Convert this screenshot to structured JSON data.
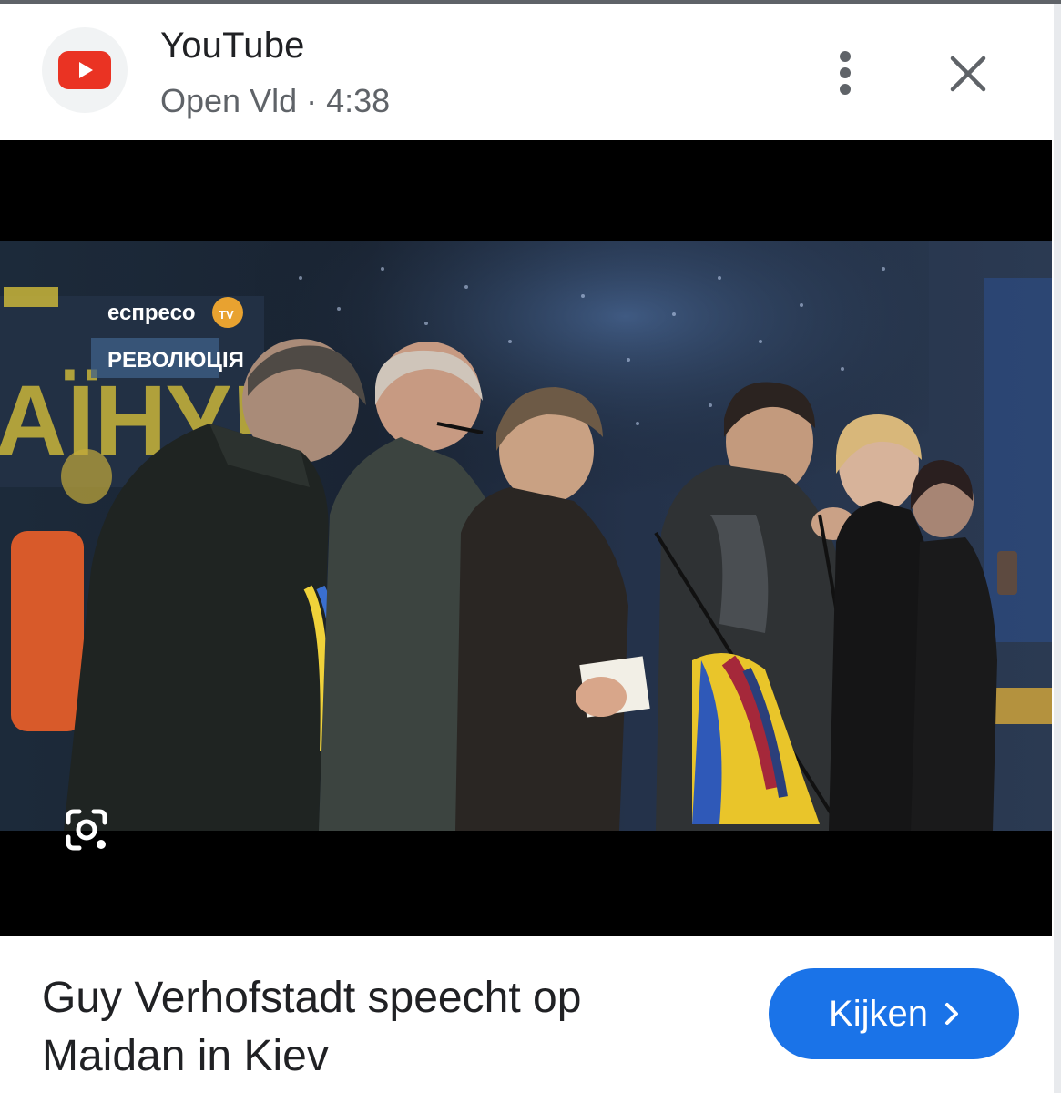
{
  "header": {
    "app_icon": "youtube-icon",
    "title": "YouTube",
    "subtitle": "Open Vld · 4:38",
    "more_icon": "more-vert-icon",
    "close_icon": "close-icon"
  },
  "video": {
    "overlay": {
      "channel_logo": "еспресо",
      "channel_badge": "TV",
      "program_label": "РЕВОЛЮЦІЯ",
      "banner_text": "АЇНУ!"
    },
    "lens_icon": "google-lens-icon"
  },
  "caption": "Guy Verhofstadt speecht op Maidan in Kiev",
  "watch_button": {
    "label": "Kijken",
    "icon": "chevron-right-icon"
  },
  "colors": {
    "accent": "#1a73e8",
    "youtube_red": "#ea3323",
    "text_primary": "#202124",
    "text_secondary": "#5f6368"
  }
}
